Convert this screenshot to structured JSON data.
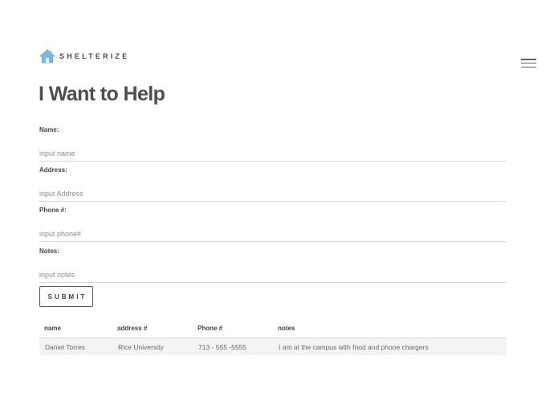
{
  "brand": {
    "icon": "house-icon",
    "name": "SHELTERIZE",
    "icon_color": "#7ab8e8"
  },
  "nav": {
    "menu_icon": "hamburger-menu-icon"
  },
  "page": {
    "title": "I Want to Help"
  },
  "form": {
    "fields": [
      {
        "label": "Name:",
        "placeholder": "input name",
        "value": ""
      },
      {
        "label": "Address:",
        "placeholder": "input Address",
        "value": ""
      },
      {
        "label": "Phone #:",
        "placeholder": "input phone#",
        "value": ""
      },
      {
        "label": "Notes:",
        "placeholder": "input notes",
        "value": ""
      }
    ],
    "submit_label": "SUBMIT"
  },
  "table": {
    "headers": [
      "name",
      "address #",
      "Phone #",
      "notes"
    ],
    "rows": [
      [
        "Daniel Torres",
        "Rice University",
        "713 - 555 -5555",
        "I am at the campus with food and phone chargers"
      ]
    ]
  }
}
